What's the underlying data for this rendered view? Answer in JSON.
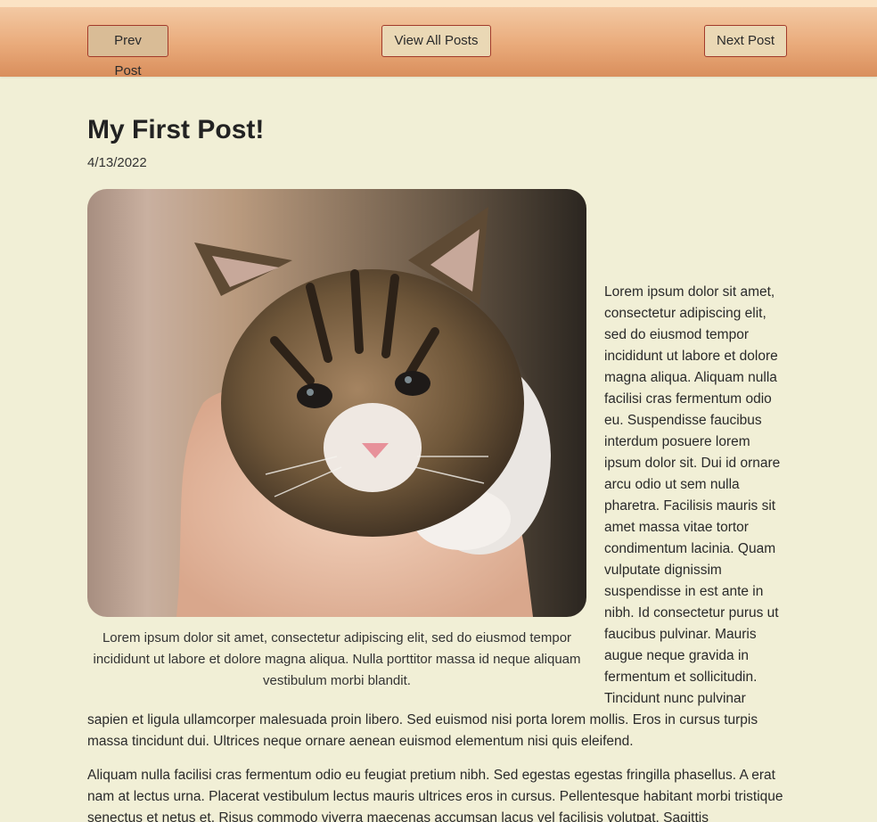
{
  "nav": {
    "prev_label": "Prev Post",
    "all_label": "View All Posts",
    "next_label": "Next Post"
  },
  "post": {
    "title": "My First Post!",
    "date": "4/13/2022",
    "image_caption": "Lorem ipsum dolor sit amet, consectetur adipiscing elit, sed do eiusmod tempor incididunt ut labore et dolore magna aliqua. Nulla porttitor massa id neque aliquam vestibulum morbi blandit.",
    "paragraph1": "Lorem ipsum dolor sit amet, consectetur adipiscing elit, sed do eiusmod tempor incididunt ut labore et dolore magna aliqua. Aliquam nulla facilisi cras fermentum odio eu. Suspendisse faucibus interdum posuere lorem ipsum dolor sit. Dui id ornare arcu odio ut sem nulla pharetra. Facilisis mauris sit amet massa vitae tortor condimentum lacinia. Quam vulputate dignissim suspendisse in est ante in nibh. Id consectetur purus ut faucibus pulvinar. Mauris augue neque gravida in fermentum et sollicitudin. Tincidunt nunc pulvinar sapien et ligula ullamcorper malesuada proin libero. Sed euismod nisi porta lorem mollis. Eros in cursus turpis massa tincidunt dui. Ultrices neque ornare aenean euismod elementum nisi quis eleifend.",
    "paragraph2": "Aliquam nulla facilisi cras fermentum odio eu feugiat pretium nibh. Sed egestas egestas fringilla phasellus. A erat nam at lectus urna. Placerat vestibulum lectus mauris ultrices eros in cursus. Pellentesque habitant morbi tristique senectus et netus et. Risus commodo viverra maecenas accumsan lacus vel facilisis volutpat. Sagittis"
  },
  "colors": {
    "background": "#f1efd6",
    "navbar": "#e9aa7a",
    "button_border": "#a23a2a"
  }
}
